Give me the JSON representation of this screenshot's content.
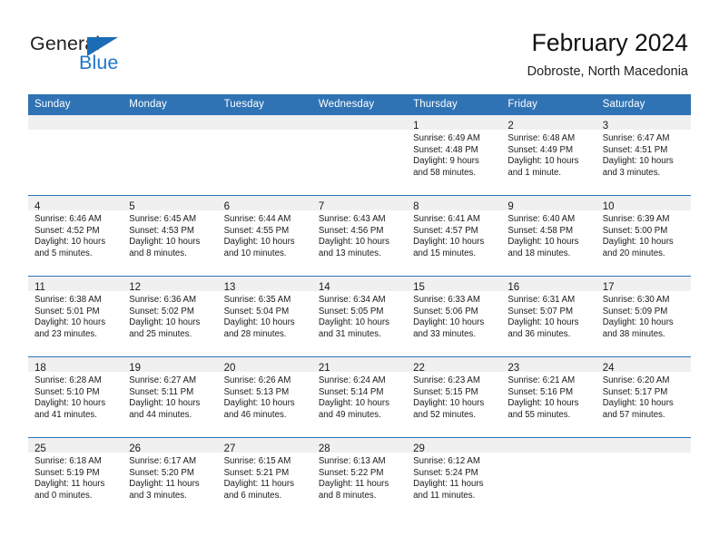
{
  "brand": {
    "name_part1": "General",
    "name_part2": "Blue",
    "triangle_color": "#1b6cb5",
    "blue_text_color": "#2277c8"
  },
  "header": {
    "title": "February 2024",
    "location": "Dobroste, North Macedonia"
  },
  "theme": {
    "header_blue": "#2f73b4",
    "band_gray": "#f0f0f0",
    "text": "#1a1a1a"
  },
  "calendar": {
    "weekday_headers": [
      "Sunday",
      "Monday",
      "Tuesday",
      "Wednesday",
      "Thursday",
      "Friday",
      "Saturday"
    ],
    "weeks": [
      [
        {
          "day": "",
          "sunrise": "",
          "sunset": "",
          "daylight_1": "",
          "daylight_2": ""
        },
        {
          "day": "",
          "sunrise": "",
          "sunset": "",
          "daylight_1": "",
          "daylight_2": ""
        },
        {
          "day": "",
          "sunrise": "",
          "sunset": "",
          "daylight_1": "",
          "daylight_2": ""
        },
        {
          "day": "",
          "sunrise": "",
          "sunset": "",
          "daylight_1": "",
          "daylight_2": ""
        },
        {
          "day": "1",
          "sunrise": "Sunrise: 6:49 AM",
          "sunset": "Sunset: 4:48 PM",
          "daylight_1": "Daylight: 9 hours",
          "daylight_2": "and 58 minutes."
        },
        {
          "day": "2",
          "sunrise": "Sunrise: 6:48 AM",
          "sunset": "Sunset: 4:49 PM",
          "daylight_1": "Daylight: 10 hours",
          "daylight_2": "and 1 minute."
        },
        {
          "day": "3",
          "sunrise": "Sunrise: 6:47 AM",
          "sunset": "Sunset: 4:51 PM",
          "daylight_1": "Daylight: 10 hours",
          "daylight_2": "and 3 minutes."
        }
      ],
      [
        {
          "day": "4",
          "sunrise": "Sunrise: 6:46 AM",
          "sunset": "Sunset: 4:52 PM",
          "daylight_1": "Daylight: 10 hours",
          "daylight_2": "and 5 minutes."
        },
        {
          "day": "5",
          "sunrise": "Sunrise: 6:45 AM",
          "sunset": "Sunset: 4:53 PM",
          "daylight_1": "Daylight: 10 hours",
          "daylight_2": "and 8 minutes."
        },
        {
          "day": "6",
          "sunrise": "Sunrise: 6:44 AM",
          "sunset": "Sunset: 4:55 PM",
          "daylight_1": "Daylight: 10 hours",
          "daylight_2": "and 10 minutes."
        },
        {
          "day": "7",
          "sunrise": "Sunrise: 6:43 AM",
          "sunset": "Sunset: 4:56 PM",
          "daylight_1": "Daylight: 10 hours",
          "daylight_2": "and 13 minutes."
        },
        {
          "day": "8",
          "sunrise": "Sunrise: 6:41 AM",
          "sunset": "Sunset: 4:57 PM",
          "daylight_1": "Daylight: 10 hours",
          "daylight_2": "and 15 minutes."
        },
        {
          "day": "9",
          "sunrise": "Sunrise: 6:40 AM",
          "sunset": "Sunset: 4:58 PM",
          "daylight_1": "Daylight: 10 hours",
          "daylight_2": "and 18 minutes."
        },
        {
          "day": "10",
          "sunrise": "Sunrise: 6:39 AM",
          "sunset": "Sunset: 5:00 PM",
          "daylight_1": "Daylight: 10 hours",
          "daylight_2": "and 20 minutes."
        }
      ],
      [
        {
          "day": "11",
          "sunrise": "Sunrise: 6:38 AM",
          "sunset": "Sunset: 5:01 PM",
          "daylight_1": "Daylight: 10 hours",
          "daylight_2": "and 23 minutes."
        },
        {
          "day": "12",
          "sunrise": "Sunrise: 6:36 AM",
          "sunset": "Sunset: 5:02 PM",
          "daylight_1": "Daylight: 10 hours",
          "daylight_2": "and 25 minutes."
        },
        {
          "day": "13",
          "sunrise": "Sunrise: 6:35 AM",
          "sunset": "Sunset: 5:04 PM",
          "daylight_1": "Daylight: 10 hours",
          "daylight_2": "and 28 minutes."
        },
        {
          "day": "14",
          "sunrise": "Sunrise: 6:34 AM",
          "sunset": "Sunset: 5:05 PM",
          "daylight_1": "Daylight: 10 hours",
          "daylight_2": "and 31 minutes."
        },
        {
          "day": "15",
          "sunrise": "Sunrise: 6:33 AM",
          "sunset": "Sunset: 5:06 PM",
          "daylight_1": "Daylight: 10 hours",
          "daylight_2": "and 33 minutes."
        },
        {
          "day": "16",
          "sunrise": "Sunrise: 6:31 AM",
          "sunset": "Sunset: 5:07 PM",
          "daylight_1": "Daylight: 10 hours",
          "daylight_2": "and 36 minutes."
        },
        {
          "day": "17",
          "sunrise": "Sunrise: 6:30 AM",
          "sunset": "Sunset: 5:09 PM",
          "daylight_1": "Daylight: 10 hours",
          "daylight_2": "and 38 minutes."
        }
      ],
      [
        {
          "day": "18",
          "sunrise": "Sunrise: 6:28 AM",
          "sunset": "Sunset: 5:10 PM",
          "daylight_1": "Daylight: 10 hours",
          "daylight_2": "and 41 minutes."
        },
        {
          "day": "19",
          "sunrise": "Sunrise: 6:27 AM",
          "sunset": "Sunset: 5:11 PM",
          "daylight_1": "Daylight: 10 hours",
          "daylight_2": "and 44 minutes."
        },
        {
          "day": "20",
          "sunrise": "Sunrise: 6:26 AM",
          "sunset": "Sunset: 5:13 PM",
          "daylight_1": "Daylight: 10 hours",
          "daylight_2": "and 46 minutes."
        },
        {
          "day": "21",
          "sunrise": "Sunrise: 6:24 AM",
          "sunset": "Sunset: 5:14 PM",
          "daylight_1": "Daylight: 10 hours",
          "daylight_2": "and 49 minutes."
        },
        {
          "day": "22",
          "sunrise": "Sunrise: 6:23 AM",
          "sunset": "Sunset: 5:15 PM",
          "daylight_1": "Daylight: 10 hours",
          "daylight_2": "and 52 minutes."
        },
        {
          "day": "23",
          "sunrise": "Sunrise: 6:21 AM",
          "sunset": "Sunset: 5:16 PM",
          "daylight_1": "Daylight: 10 hours",
          "daylight_2": "and 55 minutes."
        },
        {
          "day": "24",
          "sunrise": "Sunrise: 6:20 AM",
          "sunset": "Sunset: 5:17 PM",
          "daylight_1": "Daylight: 10 hours",
          "daylight_2": "and 57 minutes."
        }
      ],
      [
        {
          "day": "25",
          "sunrise": "Sunrise: 6:18 AM",
          "sunset": "Sunset: 5:19 PM",
          "daylight_1": "Daylight: 11 hours",
          "daylight_2": "and 0 minutes."
        },
        {
          "day": "26",
          "sunrise": "Sunrise: 6:17 AM",
          "sunset": "Sunset: 5:20 PM",
          "daylight_1": "Daylight: 11 hours",
          "daylight_2": "and 3 minutes."
        },
        {
          "day": "27",
          "sunrise": "Sunrise: 6:15 AM",
          "sunset": "Sunset: 5:21 PM",
          "daylight_1": "Daylight: 11 hours",
          "daylight_2": "and 6 minutes."
        },
        {
          "day": "28",
          "sunrise": "Sunrise: 6:13 AM",
          "sunset": "Sunset: 5:22 PM",
          "daylight_1": "Daylight: 11 hours",
          "daylight_2": "and 8 minutes."
        },
        {
          "day": "29",
          "sunrise": "Sunrise: 6:12 AM",
          "sunset": "Sunset: 5:24 PM",
          "daylight_1": "Daylight: 11 hours",
          "daylight_2": "and 11 minutes."
        },
        {
          "day": "",
          "sunrise": "",
          "sunset": "",
          "daylight_1": "",
          "daylight_2": ""
        },
        {
          "day": "",
          "sunrise": "",
          "sunset": "",
          "daylight_1": "",
          "daylight_2": ""
        }
      ]
    ]
  }
}
